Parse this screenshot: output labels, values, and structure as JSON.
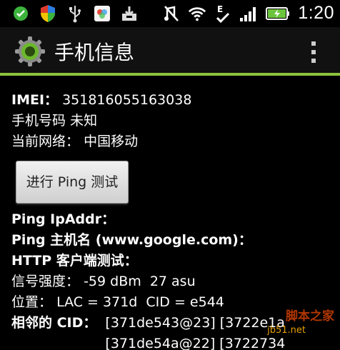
{
  "status_bar": {
    "left_icons": [
      "check-circle-icon",
      "shield-icon",
      "usb-icon",
      "photo-app-icon",
      "download-icon"
    ],
    "right_icons": [
      "mute-icon",
      "wifi-icon",
      "edge-signal-icon",
      "signal-bars-icon",
      "battery-charging-icon"
    ],
    "time": "1:20"
  },
  "action_bar": {
    "title": "手机信息",
    "accent_color": "#8cc43c"
  },
  "info": {
    "imei_label": "IMEI：",
    "imei_value": "351816055163038",
    "phone_label": "手机号码",
    "phone_value": "未知",
    "network_label": "当前网络：",
    "network_value": "中国移动",
    "ping_button": "进行 Ping 测试",
    "ping_ipaddr": "Ping IpAddr：",
    "ping_host": "Ping 主机名 (www.google.com)：",
    "http_test": "HTTP 客户端测试：",
    "signal_label": "信号强度：",
    "signal_value": "-59 dBm  27 asu",
    "location_label": "位置：",
    "location_value": "LAC = 371d  CID = e544",
    "neighbor_label": "相邻的 CID：",
    "neighbor_line1": "[371de543@23] [3722e1a",
    "neighbor_line2": "[371de54a@22] [3722734"
  },
  "watermark": {
    "text1": "脚本之家",
    "text2": "jb51.net"
  }
}
